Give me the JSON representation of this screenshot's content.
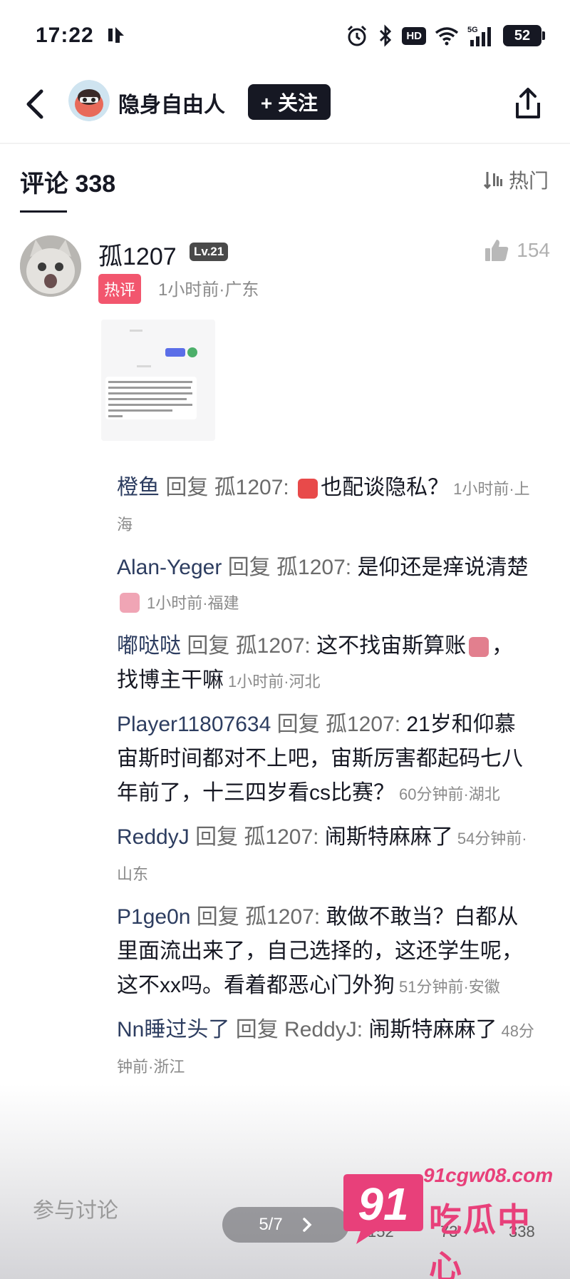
{
  "status_bar": {
    "time": "17:22",
    "network": "5G",
    "hd": "HD",
    "battery": "52"
  },
  "header": {
    "author_name": "隐身自由人",
    "follow_label": "+ 关注"
  },
  "comments_header": {
    "title": "评论 338",
    "sort_label": "热门"
  },
  "main_comment": {
    "username": "孤1207",
    "level": "Lv.21",
    "hot_badge": "热评",
    "meta": "1小时前·广东",
    "like_count": "154"
  },
  "replies": [
    {
      "user": "橙鱼",
      "verb": "回复",
      "target": "孤1207:",
      "text_before": "",
      "emoji_color": "#e84a4a",
      "text_after": "也配谈隐私？",
      "meta": "1小时前·上海"
    },
    {
      "user": "Alan-Yeger",
      "verb": "回复",
      "target": "孤1207:",
      "text_before": "是仰还是痒说清楚",
      "emoji_color": "#f0a5b5",
      "text_after": "",
      "meta": "1小时前·福建"
    },
    {
      "user": "嘟哒哒",
      "verb": "回复",
      "target": "孤1207:",
      "text_before": "这不找宙斯算账",
      "emoji_color": "#e27f8e",
      "text_after": "，找博主干嘛",
      "meta": "1小时前·河北"
    },
    {
      "user": "Player11807634",
      "verb": "回复",
      "target": "孤1207:",
      "text_before": "21岁和仰慕宙斯时间都对不上吧，宙斯厉害都起码七八年前了，十三四岁看cs比赛？",
      "emoji_color": "",
      "text_after": "",
      "meta": "60分钟前·湖北"
    },
    {
      "user": "ReddyJ",
      "verb": "回复",
      "target": "孤1207:",
      "text_before": "闹斯特麻麻了",
      "emoji_color": "",
      "text_after": "",
      "meta": "54分钟前·山东"
    },
    {
      "user": "P1ge0n",
      "verb": "回复",
      "target": "孤1207:",
      "text_before": "敢做不敢当？白都从里面流出来了，自己选择的，这还学生呢，这不xx吗。看着都恶心门外狗",
      "emoji_color": "",
      "text_after": "",
      "meta": "51分钟前·安徽"
    },
    {
      "user": "Nn睡过头了",
      "verb": "回复",
      "target": "ReddyJ:",
      "text_before": "闹斯特麻麻了",
      "emoji_color": "",
      "text_after": "",
      "meta": "48分钟前·浙江"
    }
  ],
  "bottom_bar": {
    "input_placeholder": "参与讨论",
    "pager": "5/7",
    "like_count": "152",
    "fav_count": "73",
    "comment_count": "338"
  },
  "watermark": {
    "logo": "91",
    "url": "91cgw08.com",
    "title": "吃瓜中心"
  },
  "colors": {
    "accent_pink": "#e8407a",
    "hot_red": "#f2566e",
    "reply_name": "#2d3d60"
  }
}
